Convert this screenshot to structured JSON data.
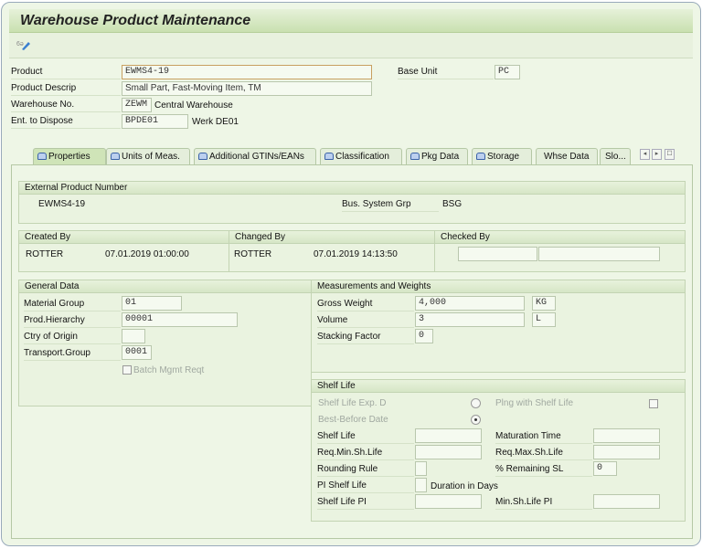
{
  "title": "Warehouse Product Maintenance",
  "toolbar": {
    "icon": "display-change-icon"
  },
  "header": {
    "product_label": "Product",
    "product_value": "EWMS4-19",
    "descr_label": "Product Descrip",
    "descr_value": "Small Part, Fast-Moving Item, TM",
    "whse_label": "Warehouse No.",
    "whse_value": "ZEWM",
    "whse_text": "Central Warehouse",
    "ent_label": "Ent. to Dispose",
    "ent_value": "BPDE01",
    "ent_text": "Werk DE01",
    "base_unit_label": "Base Unit",
    "base_unit_value": "PC"
  },
  "tabs": [
    {
      "label": "Properties",
      "active": true
    },
    {
      "label": "Units of Meas."
    },
    {
      "label": "Additional GTINs/EANs"
    },
    {
      "label": "Classification"
    },
    {
      "label": "Pkg Data"
    },
    {
      "label": "Storage"
    },
    {
      "label": "Whse Data"
    },
    {
      "label": "Slo..."
    }
  ],
  "tab_nav": {
    "prev": "◂",
    "next": "▸",
    "list": "☐"
  },
  "ext": {
    "title": "External Product Number",
    "value": "EWMS4-19",
    "bsg_label": "Bus. System Grp",
    "bsg_value": "BSG"
  },
  "created": {
    "title": "Created By",
    "user": "ROTTER",
    "date": "07.01.2019 01:00:00"
  },
  "changed": {
    "title": "Changed By",
    "user": "ROTTER",
    "date": "07.01.2019 14:13:50"
  },
  "checked": {
    "title": "Checked By",
    "user": "",
    "date": ""
  },
  "general": {
    "title": "General Data",
    "material_group_label": "Material Group",
    "material_group": "01",
    "prod_hier_label": "Prod.Hierarchy",
    "prod_hier": "00001",
    "ctry_label": "Ctry of Origin",
    "ctry": "",
    "transport_label": "Transport.Group",
    "transport": "0001",
    "batch_label": "Batch Mgmt Reqt",
    "batch_checked": false
  },
  "measure": {
    "title": "Measurements and Weights",
    "gross_label": "Gross Weight",
    "gross": "4,000",
    "gross_unit": "KG",
    "volume_label": "Volume",
    "volume": "3",
    "volume_unit": "L",
    "stack_label": "Stacking Factor",
    "stack": "0"
  },
  "shelf": {
    "title": "Shelf Life",
    "exp_label": "Shelf Life Exp. D",
    "bbd_label": "Best-Before Date",
    "selected": "Best-Before Date",
    "plng_label": "Plng with Shelf Life",
    "plng_checked": false,
    "sl_label": "Shelf Life",
    "sl": "",
    "mat_label": "Maturation Time",
    "mat": "",
    "reqmin_label": "Req.Min.Sh.Life",
    "reqmin": "",
    "reqmax_label": "Req.Max.Sh.Life",
    "reqmax": "",
    "round_label": "Rounding Rule",
    "round": "",
    "remain_label": "% Remaining SL",
    "remain": "0",
    "pi_label": "PI Shelf Life",
    "pi": "",
    "pi_text": "Duration in Days",
    "slpi_label": "Shelf Life PI",
    "slpi": "",
    "minpi_label": "Min.Sh.Life PI",
    "minpi": ""
  }
}
